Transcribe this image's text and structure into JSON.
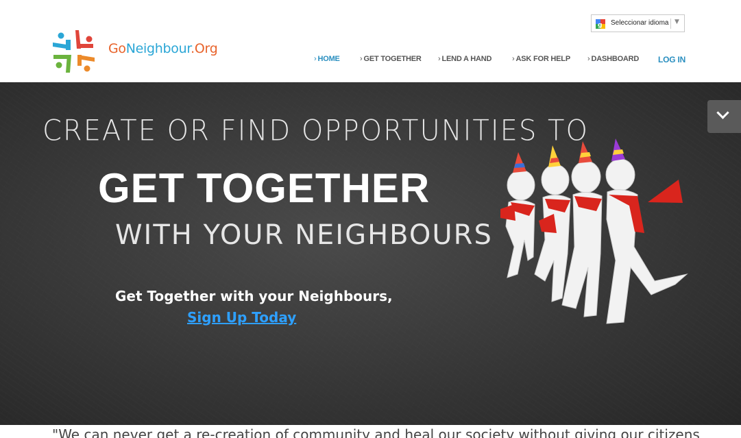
{
  "brand": {
    "go": "Go",
    "neighbour": "Neighbour",
    "org": ".Org"
  },
  "language": {
    "label": "Seleccionar idioma",
    "arrow": "▼"
  },
  "nav": {
    "chev": "›",
    "home": "HOME",
    "get_together": "GET TOGETHER",
    "lend_a_hand": "LEND A HAND",
    "ask_for_help": "ASK FOR HELP",
    "dashboard": "DASHBOARD",
    "login": "LOG IN"
  },
  "hero": {
    "line1": "CREATE OR FIND OPPORTUNITIES TO",
    "line2": "GET TOGETHER",
    "line3": "WITH YOUR NEIGHBOURS",
    "cta_text": "Get Together with your Neighbours,",
    "cta_link": "Sign Up Today"
  },
  "quote": "\"We can never get a re-creation of community and heal our society without giving our citizens"
}
